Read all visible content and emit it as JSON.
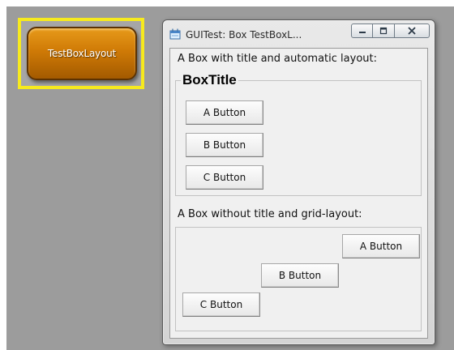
{
  "app_button": {
    "label": "TestBoxLayout"
  },
  "window": {
    "title": "GUITest: Box TestBoxL...",
    "caption_buttons": {
      "minimize": "minimize-icon",
      "maximize": "maximize-icon",
      "close": "close-icon"
    }
  },
  "section1": {
    "label": "A Box with title and automatic layout:",
    "group_title": "BoxTitle",
    "buttons": [
      "A Button",
      "B Button",
      "C Button"
    ]
  },
  "section2": {
    "label": "A Box without title and grid-layout:",
    "buttons": [
      "A Button",
      "B Button",
      "C Button"
    ]
  },
  "colors": {
    "highlight": "#f7ea1e",
    "app_button": "#cf7a06",
    "desktop": "#9c9c9c"
  }
}
